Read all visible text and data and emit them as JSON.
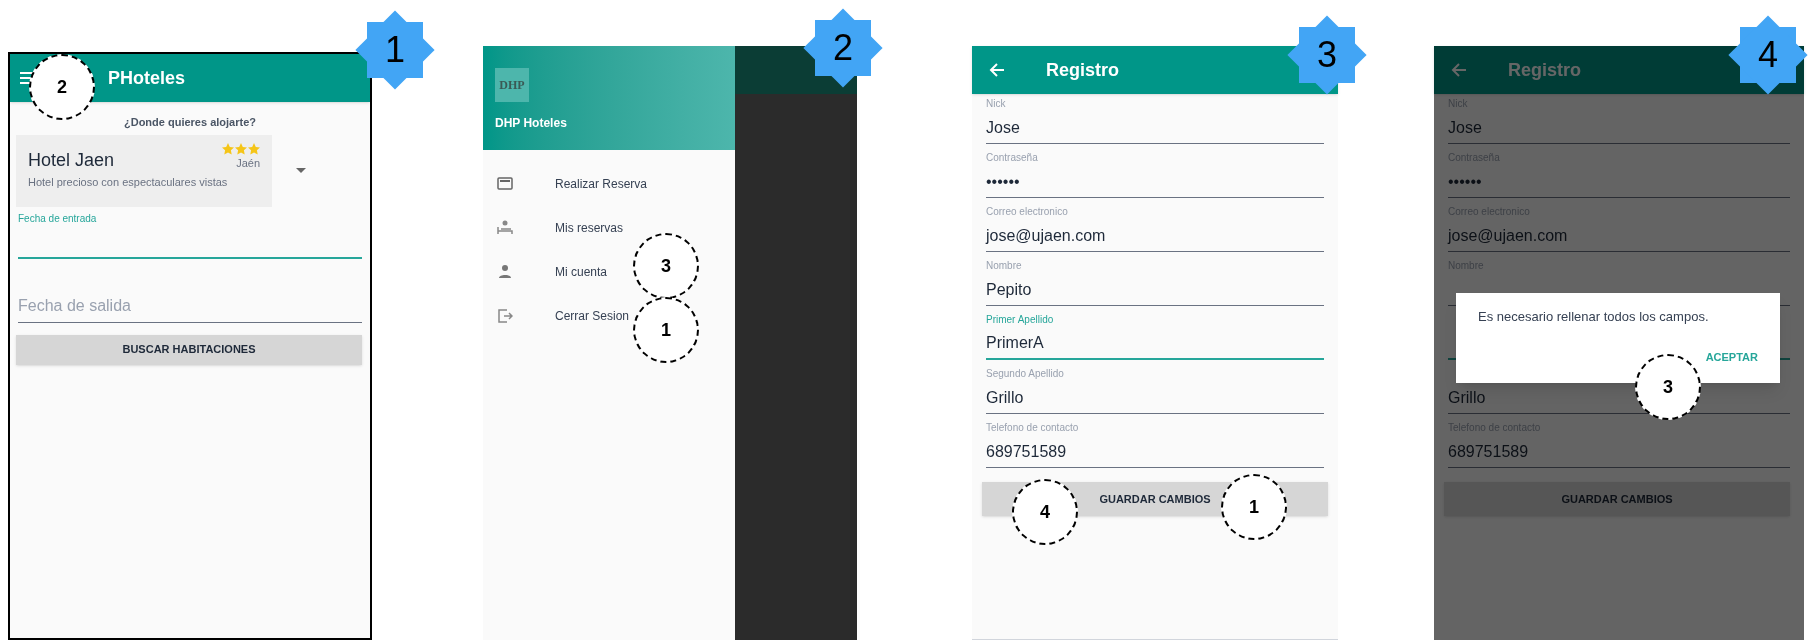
{
  "screens": [
    {
      "kind": "search",
      "step": "1",
      "title": "PHoteles",
      "prompt": "¿Donde quieres alojarte?",
      "hotel": {
        "name": "Hotel Jaen",
        "city": "Jaén",
        "description": "Hotel precioso con espectaculares vistas",
        "stars": 3
      },
      "fields": [
        {
          "label": "Fecha de entrada",
          "focused": true
        },
        {
          "placeholder": "Fecha de salida",
          "focused": false
        }
      ],
      "button": "BUSCAR HABITACIONES",
      "callouts": [
        "2"
      ]
    },
    {
      "kind": "drawer",
      "step": "2",
      "logo": "DHP",
      "title": "DHP Hoteles",
      "items": [
        {
          "label": "Realizar Reserva"
        },
        {
          "label": "Mis reservas"
        },
        {
          "label": "Mi cuenta"
        },
        {
          "label": "Cerrar Sesion"
        }
      ],
      "callouts": [
        "3",
        "1"
      ]
    },
    {
      "kind": "form",
      "step": "3",
      "title": "Registro",
      "dimmed": false,
      "fields": [
        {
          "label": "Nick",
          "value": "Jose",
          "focused": false
        },
        {
          "label": "Contraseña",
          "value": "••••••",
          "focused": false
        },
        {
          "label": "Correo electronico",
          "value": "jose@ujaen.com",
          "focused": false
        },
        {
          "label": "Nombre",
          "value": "Pepito",
          "focused": false
        },
        {
          "label": "Primer Apellido",
          "value": "PrimerA",
          "focused": true
        },
        {
          "label": "Segundo Apellido",
          "value": "Grillo",
          "focused": false
        },
        {
          "label": "Telefono de contacto",
          "value": "689751589",
          "focused": false
        }
      ],
      "button": "GUARDAR CAMBIOS",
      "callouts": [
        "4",
        "1"
      ]
    },
    {
      "kind": "form",
      "step": "4",
      "title": "Registro",
      "dimmed": true,
      "fields": [
        {
          "label": "Nick",
          "value": "Jose",
          "focused": false
        },
        {
          "label": "Contraseña",
          "value": "••••••",
          "focused": false
        },
        {
          "label": "Correo electronico",
          "value": "jose@ujaen.com",
          "focused": false
        },
        {
          "label": "Nombre",
          "focused": false
        },
        {
          "focused": true
        },
        {
          "value": "Grillo",
          "focused": false
        },
        {
          "label": "Telefono de contacto",
          "value": "689751589",
          "focused": false
        }
      ],
      "button": "GUARDAR CAMBIOS",
      "dialog": {
        "message": "Es necesario rellenar todos los campos.",
        "action": "ACEPTAR"
      },
      "callouts": [
        "3"
      ]
    }
  ]
}
